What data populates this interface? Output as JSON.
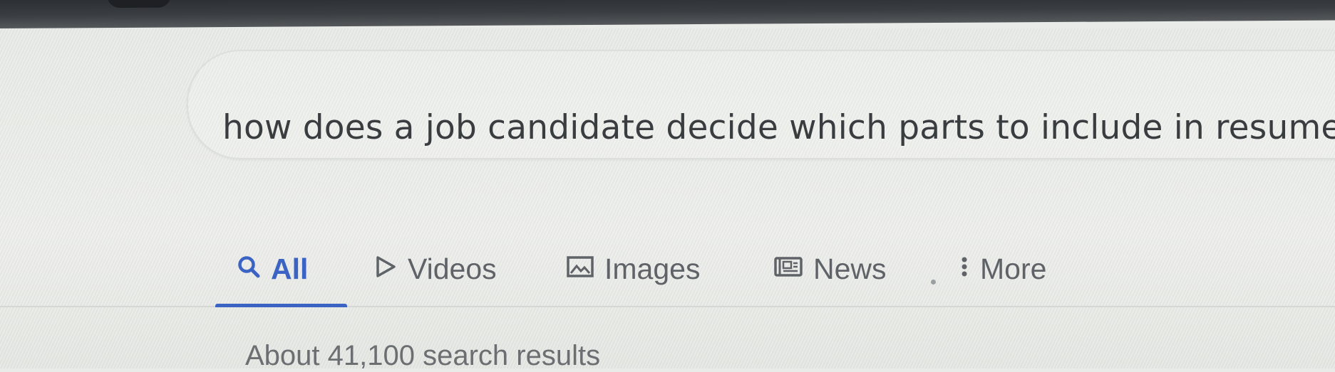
{
  "search": {
    "query": "how does a job candidate decide which parts to include in resume"
  },
  "tabs": [
    {
      "label": "All",
      "icon": "search-icon",
      "active": true
    },
    {
      "label": "Videos",
      "icon": "play-icon",
      "active": false
    },
    {
      "label": "Images",
      "icon": "image-icon",
      "active": false
    },
    {
      "label": "News",
      "icon": "newspaper-icon",
      "active": false
    },
    {
      "label": "More",
      "icon": "more-vertical-icon",
      "active": false
    }
  ],
  "results": {
    "count_text": "About 41,100 search results"
  },
  "colors": {
    "accent": "#3b63c4",
    "tab_text": "#5f6368",
    "query_text": "#3a3d40"
  }
}
